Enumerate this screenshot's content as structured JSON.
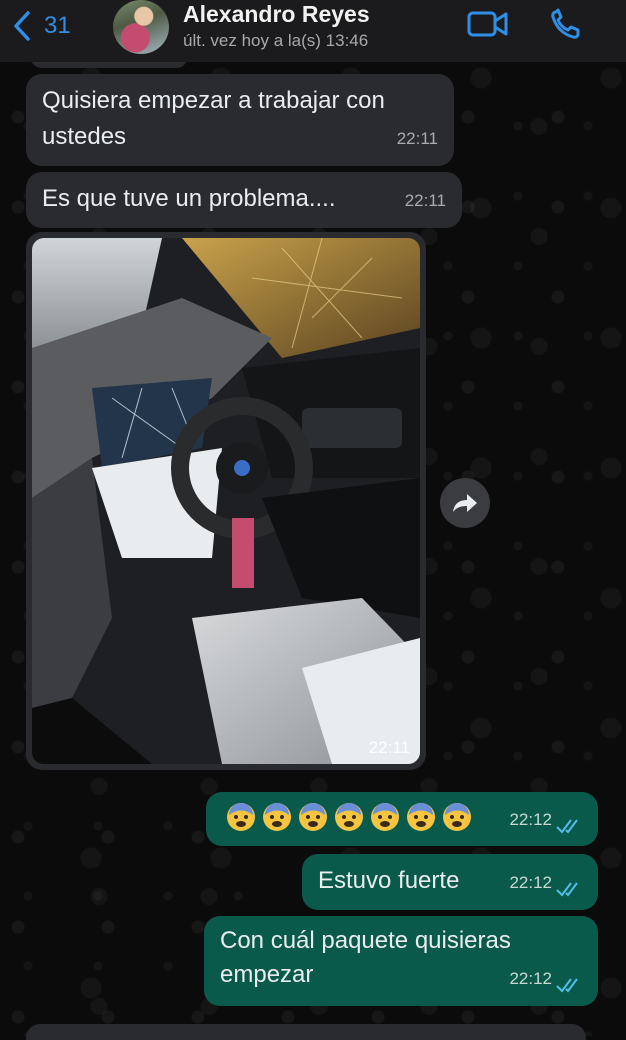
{
  "header": {
    "back_count": "31",
    "contact_name": "Alexandro Reyes",
    "last_seen": "últ. vez hoy a la(s) 13:46"
  },
  "messages": [
    {
      "direction": "in",
      "text_lines": [
        "Quisiera empezar a trabajar con",
        "ustedes"
      ],
      "time": "22:11"
    },
    {
      "direction": "in",
      "text": "Es que tuve un problema....",
      "time": "22:11"
    },
    {
      "direction": "in",
      "type": "image",
      "time": "22:11"
    },
    {
      "direction": "out",
      "text": "😨😨😨😨😨😨😨",
      "time": "22:12",
      "status": "read"
    },
    {
      "direction": "out",
      "text": "Estuvo fuerte",
      "time": "22:12",
      "status": "read"
    },
    {
      "direction": "out",
      "text_lines": [
        "Con cuál paquete quisieras",
        "empezar"
      ],
      "time": "22:12",
      "status": "read"
    }
  ],
  "icons": {
    "back": "chevron-left-icon",
    "video": "video-camera-icon",
    "call": "phone-icon",
    "forward": "forward-arrow-icon",
    "read_receipt": "double-check-icon"
  },
  "colors": {
    "accent": "#2f8fe6",
    "incoming_bubble": "#2a2b2f",
    "outgoing_bubble": "#0a5a4b",
    "read_tick": "#53bdeb"
  }
}
